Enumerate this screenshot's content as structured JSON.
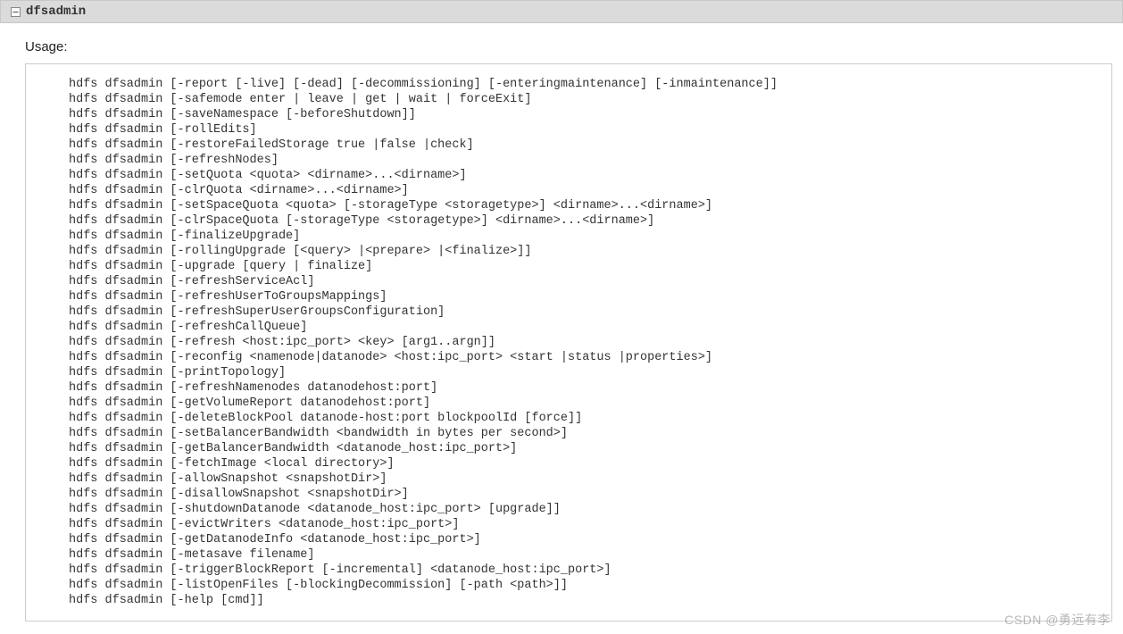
{
  "header": {
    "title": "dfsadmin"
  },
  "usage_label": "Usage:",
  "code_lines": [
    "hdfs dfsadmin [-report [-live] [-dead] [-decommissioning] [-enteringmaintenance] [-inmaintenance]]",
    "hdfs dfsadmin [-safemode enter | leave | get | wait | forceExit]",
    "hdfs dfsadmin [-saveNamespace [-beforeShutdown]]",
    "hdfs dfsadmin [-rollEdits]",
    "hdfs dfsadmin [-restoreFailedStorage true |false |check]",
    "hdfs dfsadmin [-refreshNodes]",
    "hdfs dfsadmin [-setQuota <quota> <dirname>...<dirname>]",
    "hdfs dfsadmin [-clrQuota <dirname>...<dirname>]",
    "hdfs dfsadmin [-setSpaceQuota <quota> [-storageType <storagetype>] <dirname>...<dirname>]",
    "hdfs dfsadmin [-clrSpaceQuota [-storageType <storagetype>] <dirname>...<dirname>]",
    "hdfs dfsadmin [-finalizeUpgrade]",
    "hdfs dfsadmin [-rollingUpgrade [<query> |<prepare> |<finalize>]]",
    "hdfs dfsadmin [-upgrade [query | finalize]",
    "hdfs dfsadmin [-refreshServiceAcl]",
    "hdfs dfsadmin [-refreshUserToGroupsMappings]",
    "hdfs dfsadmin [-refreshSuperUserGroupsConfiguration]",
    "hdfs dfsadmin [-refreshCallQueue]",
    "hdfs dfsadmin [-refresh <host:ipc_port> <key> [arg1..argn]]",
    "hdfs dfsadmin [-reconfig <namenode|datanode> <host:ipc_port> <start |status |properties>]",
    "hdfs dfsadmin [-printTopology]",
    "hdfs dfsadmin [-refreshNamenodes datanodehost:port]",
    "hdfs dfsadmin [-getVolumeReport datanodehost:port]",
    "hdfs dfsadmin [-deleteBlockPool datanode-host:port blockpoolId [force]]",
    "hdfs dfsadmin [-setBalancerBandwidth <bandwidth in bytes per second>]",
    "hdfs dfsadmin [-getBalancerBandwidth <datanode_host:ipc_port>]",
    "hdfs dfsadmin [-fetchImage <local directory>]",
    "hdfs dfsadmin [-allowSnapshot <snapshotDir>]",
    "hdfs dfsadmin [-disallowSnapshot <snapshotDir>]",
    "hdfs dfsadmin [-shutdownDatanode <datanode_host:ipc_port> [upgrade]]",
    "hdfs dfsadmin [-evictWriters <datanode_host:ipc_port>]",
    "hdfs dfsadmin [-getDatanodeInfo <datanode_host:ipc_port>]",
    "hdfs dfsadmin [-metasave filename]",
    "hdfs dfsadmin [-triggerBlockReport [-incremental] <datanode_host:ipc_port>]",
    "hdfs dfsadmin [-listOpenFiles [-blockingDecommission] [-path <path>]]",
    "hdfs dfsadmin [-help [cmd]]"
  ],
  "watermark": "CSDN @勇远有李"
}
